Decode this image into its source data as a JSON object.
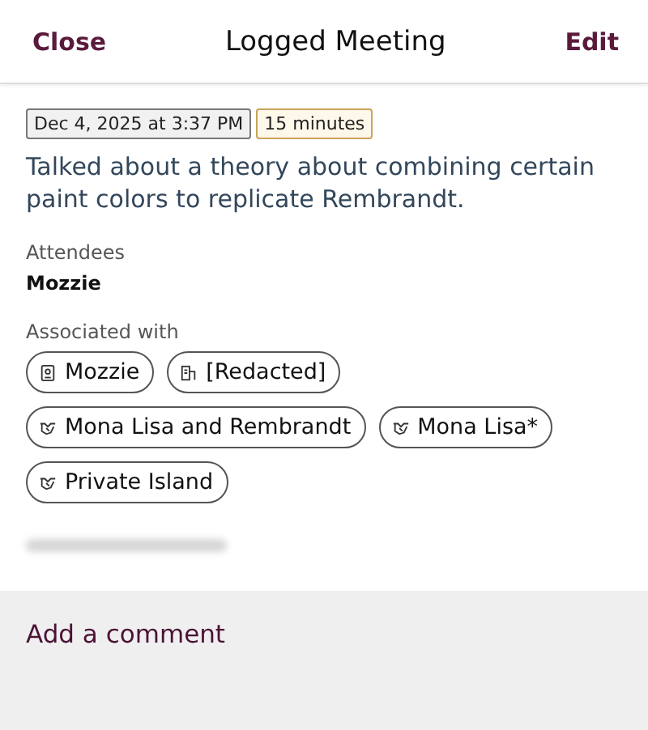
{
  "header": {
    "close": "Close",
    "title": "Logged Meeting",
    "edit": "Edit"
  },
  "tags": [
    {
      "kind": "date",
      "text": "Dec 4, 2025 at 3:37 PM"
    },
    {
      "kind": "duration",
      "text": "15 minutes"
    }
  ],
  "body": "Talked about a theory about combining certain paint colors to replicate Rembrandt.",
  "attendees": {
    "label": "Attendees",
    "names": [
      "Mozzie"
    ]
  },
  "associated": {
    "label": "Associated with",
    "items": [
      {
        "kind": "contact",
        "text": "Mozzie"
      },
      {
        "kind": "company",
        "text": "[Redacted]"
      },
      {
        "kind": "deal",
        "text": "Mona Lisa and Rembrandt"
      },
      {
        "kind": "deal",
        "text": "Mona Lisa*"
      },
      {
        "kind": "deal",
        "text": "Private Island"
      }
    ]
  },
  "comment": {
    "placeholder": "Add a comment"
  }
}
